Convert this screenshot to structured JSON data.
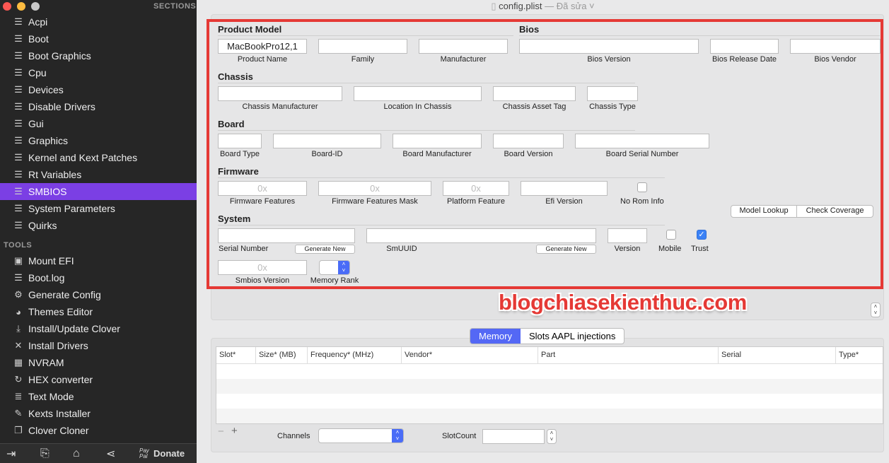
{
  "window": {
    "title": "config.plist",
    "modified": "— Đã sửa",
    "traffic_lights": [
      "#fc5753",
      "#fdbc40",
      "#c8c8c8"
    ]
  },
  "sidebar": {
    "sections_header": "SECTIONS",
    "sections": [
      {
        "label": "Acpi"
      },
      {
        "label": "Boot"
      },
      {
        "label": "Boot Graphics"
      },
      {
        "label": "Cpu"
      },
      {
        "label": "Devices"
      },
      {
        "label": "Disable Drivers"
      },
      {
        "label": "Gui"
      },
      {
        "label": "Graphics"
      },
      {
        "label": "Kernel and Kext Patches"
      },
      {
        "label": "Rt Variables"
      },
      {
        "label": "SMBIOS",
        "selected": true
      },
      {
        "label": "System Parameters"
      },
      {
        "label": "Quirks"
      }
    ],
    "tools_header": "TOOLS",
    "tools": [
      {
        "label": "Mount EFI",
        "icon": "disk-icon"
      },
      {
        "label": "Boot.log",
        "icon": "log-search-icon"
      },
      {
        "label": "Generate Config",
        "icon": "gears-icon"
      },
      {
        "label": "Themes Editor",
        "icon": "palette-icon"
      },
      {
        "label": "Install/Update Clover",
        "icon": "download-icon"
      },
      {
        "label": "Install Drivers",
        "icon": "tools-icon"
      },
      {
        "label": "NVRAM",
        "icon": "chip-icon"
      },
      {
        "label": "HEX converter",
        "icon": "refresh-icon"
      },
      {
        "label": "Text Mode",
        "icon": "text-icon"
      },
      {
        "label": "Kexts Installer",
        "icon": "plug-icon"
      },
      {
        "label": "Clover Cloner",
        "icon": "copy-icon"
      }
    ],
    "bottom": {
      "paypal": "Pay Pal",
      "donate": "Donate"
    },
    "accent": "#7b3fe4"
  },
  "smbios": {
    "groups": {
      "product": "Product Model",
      "bios": "Bios",
      "chassis": "Chassis",
      "board": "Board",
      "firmware": "Firmware",
      "system": "System"
    },
    "fields": {
      "product_name": {
        "label": "Product Name",
        "value": "MacBookPro12,1"
      },
      "family": {
        "label": "Family",
        "value": ""
      },
      "manufacturer": {
        "label": "Manufacturer",
        "value": ""
      },
      "bios_version": {
        "label": "Bios Version",
        "value": ""
      },
      "bios_release_date": {
        "label": "Bios Release Date",
        "value": ""
      },
      "bios_vendor": {
        "label": "Bios Vendor",
        "value": ""
      },
      "chassis_manufacturer": {
        "label": "Chassis Manufacturer",
        "value": ""
      },
      "location_in_chassis": {
        "label": "Location In Chassis",
        "value": ""
      },
      "chassis_asset_tag": {
        "label": "Chassis  Asset Tag",
        "value": ""
      },
      "chassis_type": {
        "label": "Chassis Type",
        "value": ""
      },
      "board_type": {
        "label": "Board Type",
        "value": ""
      },
      "board_id": {
        "label": "Board-ID",
        "value": ""
      },
      "board_manufacturer": {
        "label": "Board Manufacturer",
        "value": ""
      },
      "board_version": {
        "label": "Board Version",
        "value": ""
      },
      "board_serial": {
        "label": "Board Serial Number",
        "value": ""
      },
      "firmware_features": {
        "label": "Firmware Features",
        "placeholder": "0x"
      },
      "firmware_features_mask": {
        "label": "Firmware Features Mask",
        "placeholder": "0x"
      },
      "platform_feature": {
        "label": "Platform Feature",
        "placeholder": "0x"
      },
      "efi_version": {
        "label": "Efi Version",
        "value": ""
      },
      "serial_number": {
        "label": "Serial Number",
        "value": ""
      },
      "smuuid": {
        "label": "SmUUID",
        "value": ""
      },
      "version": {
        "label": "Version",
        "value": ""
      },
      "smbios_version": {
        "label": "Smbios Version",
        "placeholder": "0x"
      }
    },
    "no_rom_info": {
      "label": "No Rom Info",
      "checked": false
    },
    "mobile": {
      "label": "Mobile",
      "checked": false
    },
    "trust": {
      "label": "Trust",
      "checked": true
    },
    "memory_rank": {
      "label": "Memory Rank",
      "value": ""
    },
    "generate_new": "Generate New",
    "model_lookup": "Model Lookup",
    "check_coverage": "Check Coverage"
  },
  "watermark": "blogchiasekienthuc.com",
  "memory": {
    "tabs": [
      {
        "label": "Memory",
        "active": true
      },
      {
        "label": "Slots AAPL injections"
      }
    ],
    "columns": [
      "Slot*",
      "Size* (MB)",
      "Frequency* (MHz)",
      "Vendor*",
      "Part",
      "Serial",
      "Type*"
    ],
    "rows": [],
    "remove": "−",
    "add": "+",
    "channels_label": "Channels",
    "channels_value": "",
    "slotcount_label": "SlotCount",
    "slotcount_value": ""
  }
}
